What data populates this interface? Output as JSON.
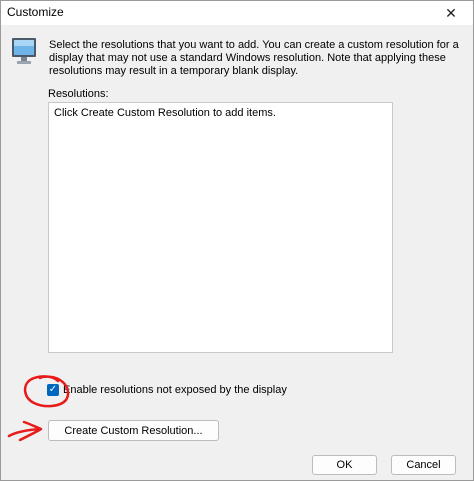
{
  "window": {
    "title": "Customize",
    "close_glyph": "✕"
  },
  "description": "Select the resolutions that you want to add. You can create a custom resolution for a display that may not use a standard Windows resolution. Note that applying these resolutions may result in a temporary blank display.",
  "resolutions": {
    "label": "Resolutions:",
    "placeholder": "Click Create Custom Resolution to add items."
  },
  "checkbox": {
    "label": "Enable resolutions not exposed by the display",
    "checked": true
  },
  "buttons": {
    "create": "Create Custom Resolution...",
    "ok": "OK",
    "cancel": "Cancel"
  },
  "icons": {
    "monitor": "monitor-icon",
    "close": "close-icon"
  },
  "colors": {
    "accent": "#0067c0",
    "annotation": "#e81b1b"
  }
}
